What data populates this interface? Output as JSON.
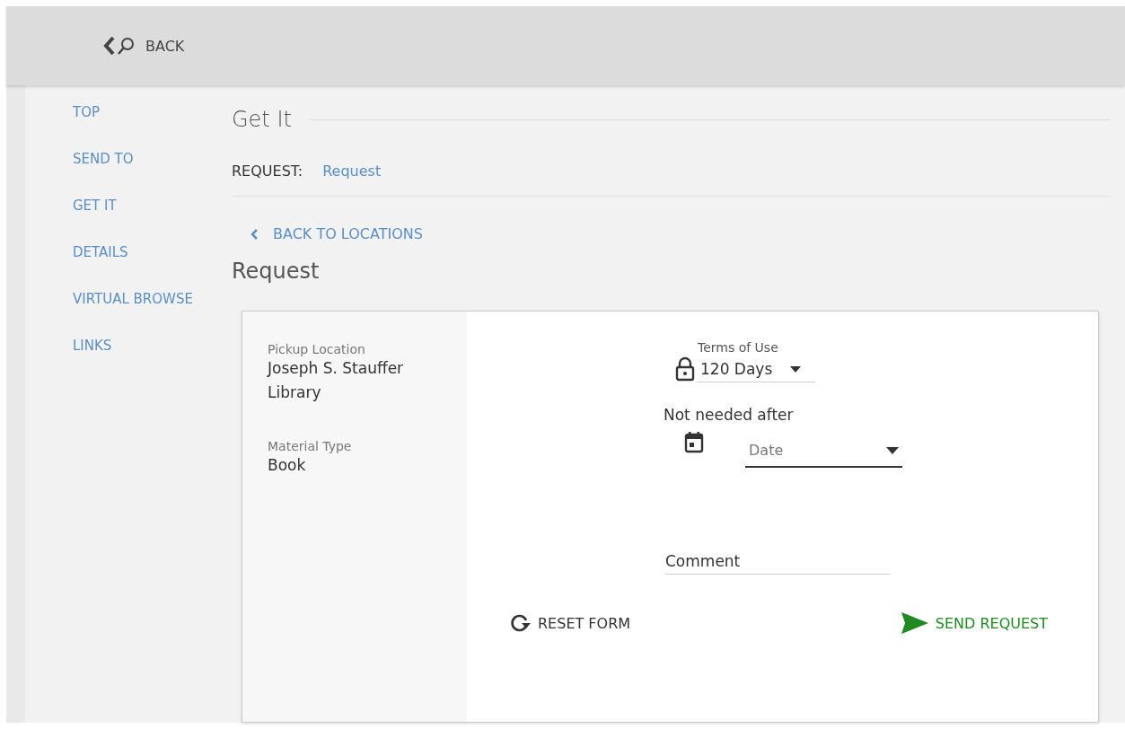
{
  "header": {
    "back_label": "BACK"
  },
  "sidebar": {
    "items": [
      {
        "label": "TOP"
      },
      {
        "label": "SEND TO"
      },
      {
        "label": "GET IT"
      },
      {
        "label": "DETAILS"
      },
      {
        "label": "VIRTUAL BROWSE"
      },
      {
        "label": "LINKS"
      }
    ]
  },
  "section": {
    "title": "Get It",
    "request_label": "REQUEST:",
    "request_link": "Request",
    "back_link": "BACK TO LOCATIONS",
    "subtitle": "Request"
  },
  "form": {
    "info": [
      {
        "label": "Pickup Location",
        "value": "Joseph S. Stauffer Library"
      },
      {
        "label": "Material Type",
        "value": "Book"
      }
    ],
    "terms": {
      "label": "Terms of Use",
      "value": "120 Days"
    },
    "not_needed": {
      "label": "Not needed after",
      "placeholder": "Date"
    },
    "comment": {
      "placeholder": "Comment"
    },
    "reset_button": "RESET FORM",
    "send_button": "SEND REQUEST"
  }
}
